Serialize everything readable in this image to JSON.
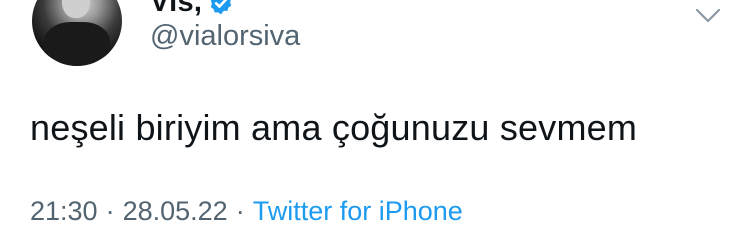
{
  "author": {
    "display_name": "Vis,",
    "handle": "@vialorsiva",
    "avatar_icon": "profile-photo",
    "verified_icon": "verified-badge-icon"
  },
  "tweet": {
    "text": "neşeli biriyim ama çoğunuzu sevmem",
    "time": "21:30",
    "date": "28.05.22",
    "separator": "·",
    "source": "Twitter for iPhone"
  },
  "colors": {
    "accent": "#1d9bf0",
    "muted": "#536471",
    "text": "#0f1419"
  }
}
